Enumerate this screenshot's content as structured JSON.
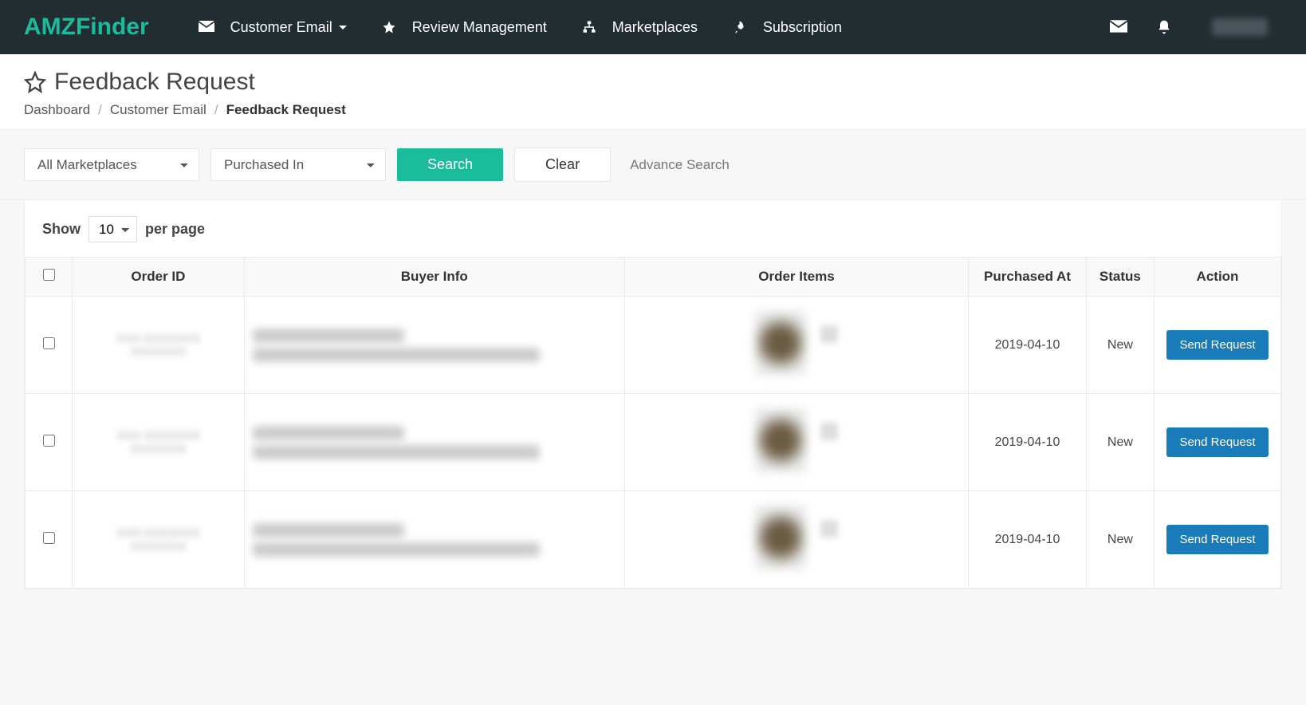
{
  "brand": "AMZFinder",
  "nav": {
    "customer_email": "Customer Email",
    "review_management": "Review Management",
    "marketplaces": "Marketplaces",
    "subscription": "Subscription"
  },
  "page": {
    "title": "Feedback Request",
    "breadcrumb": {
      "dashboard": "Dashboard",
      "customer_email": "Customer Email",
      "current": "Feedback Request"
    }
  },
  "filters": {
    "marketplaces": "All Marketplaces",
    "purchased_in": "Purchased In",
    "search_btn": "Search",
    "clear_btn": "Clear",
    "advance": "Advance Search"
  },
  "pager": {
    "show": "Show",
    "value": "10",
    "per_page": "per page"
  },
  "columns": {
    "order_id": "Order ID",
    "buyer_info": "Buyer Info",
    "order_items": "Order Items",
    "purchased_at": "Purchased At",
    "status": "Status",
    "action": "Action"
  },
  "rows": [
    {
      "purchased_at": "2019-04-10",
      "status": "New",
      "action": "Send Request"
    },
    {
      "purchased_at": "2019-04-10",
      "status": "New",
      "action": "Send Request"
    },
    {
      "purchased_at": "2019-04-10",
      "status": "New",
      "action": "Send Request"
    }
  ]
}
